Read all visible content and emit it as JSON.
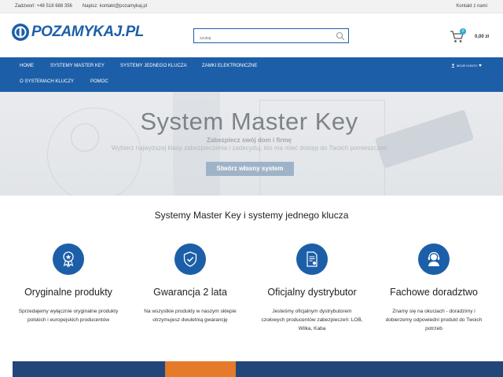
{
  "topbar": {
    "phone_label": "Zadzwoń:",
    "phone": "+48 518 688 356",
    "email_label": "Napisz:",
    "email": "kontakt@pozamykaj.pl",
    "contact_link": "Kontakt z nami"
  },
  "header": {
    "logo_text": "POZAMYKAJ.PL",
    "search_placeholder": "szukaj",
    "cart_count": "0",
    "cart_total": "0,00 zł"
  },
  "nav": {
    "items": [
      "Home",
      "Systemy Master Key",
      "Systemy jednego klucza",
      "Zamki elektroniczne",
      "O systemach kluczy",
      "Pomoc"
    ],
    "account_label": "MOJE KONTO"
  },
  "hero": {
    "title": "System Master Key",
    "subtitle": "Zabezpiecz swój dom i firmę",
    "description": "Wybierz najwyższej klasy zabezpieczenia i zadecyduj, kto ma mieć dostęp do Twoich pomieszczeń",
    "button": "Stwórz własny system"
  },
  "section": {
    "title": "Systemy Master Key i systemy jednego klucza"
  },
  "features": [
    {
      "icon": "award-ribbon-icon",
      "title": "Oryginalne produkty",
      "desc": "Sprzedajemy wyłącznie oryginalne produkty polskich i europejskich producentów"
    },
    {
      "icon": "shield-check-icon",
      "title": "Gwarancja 2 lata",
      "desc": "Na wszystkie produkty w naszym sklepie otrzymujesz dwuletnią gwarancję"
    },
    {
      "icon": "certificate-document-icon",
      "title": "Oficjalny dystrybutor",
      "desc": "Jesteśmy oficjalnym dystrybutorem czołowych producentów zabezpieczeń: LOB, Wilka, Kaba"
    },
    {
      "icon": "support-headset-icon",
      "title": "Fachowe doradztwo",
      "desc": "Znamy się na okuciach - doradzimy i dobierzemy odpowiedni produkt do Twoich potrzeb"
    }
  ],
  "colors": {
    "brand_blue": "#1c5fa8",
    "cart_badge": "#2aa6d9",
    "hero_button": "#9fb3c8"
  }
}
